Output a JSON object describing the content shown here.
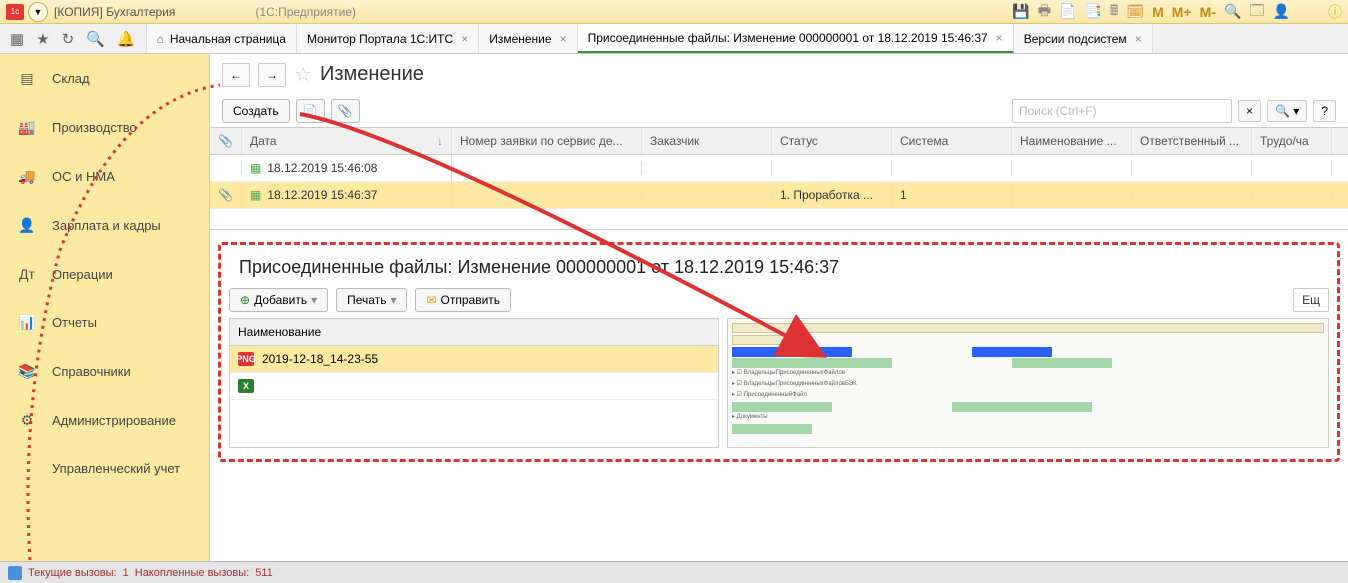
{
  "titlebar": {
    "app_title": "[КОПИЯ] Бухгалтерия",
    "app_suffix": "(1С:Предприятие)"
  },
  "tabs": {
    "home": "Начальная страница",
    "monitor": "Монитор Портала 1С:ИТС",
    "change": "Изменение",
    "attached": "Присоединенные файлы: Изменение 000000001 от 18.12.2019 15:46:37",
    "versions": "Версии подсистем"
  },
  "sidebar": {
    "items": [
      {
        "label": "Склад"
      },
      {
        "label": "Производство"
      },
      {
        "label": "ОС и НМА"
      },
      {
        "label": "Зарплата и кадры"
      },
      {
        "label": "Операции"
      },
      {
        "label": "Отчеты"
      },
      {
        "label": "Справочники"
      },
      {
        "label": "Администрирование"
      },
      {
        "label": "Управленческий учет"
      }
    ]
  },
  "page": {
    "title": "Изменение",
    "create_btn": "Создать",
    "search_placeholder": "Поиск (Ctrl+F)"
  },
  "table": {
    "headers": {
      "date": "Дата",
      "req": "Номер заявки по сервис де...",
      "customer": "Заказчик",
      "status": "Статус",
      "system": "Система",
      "name": "Наименование ...",
      "resp": "Ответственный ...",
      "labor": "Трудо/ча"
    },
    "rows": [
      {
        "date": "18.12.2019 15:46:08",
        "req": "",
        "customer": "",
        "status": "",
        "system": ""
      },
      {
        "date": "18.12.2019 15:46:37",
        "req": "",
        "customer": "",
        "status": "1. Проработка ...",
        "system": "1"
      }
    ]
  },
  "attached": {
    "title": "Присоединенные файлы: Изменение 000000001 от 18.12.2019 15:46:37",
    "add_btn": "Добавить",
    "print_btn": "Печать",
    "send_btn": "Отправить",
    "more_btn": "Ещ",
    "list_header": "Наименование",
    "files": [
      {
        "name": "2019-12-18_14-23-55",
        "type": "png"
      },
      {
        "name": "",
        "type": "xls"
      }
    ]
  },
  "statusbar": {
    "current_label": "Текущие вызовы:",
    "current_val": "1",
    "acc_label": "Накопленные вызовы:",
    "acc_val": "511"
  },
  "title_tools": {
    "m": "M",
    "mp": "M+",
    "mm": "M-"
  }
}
